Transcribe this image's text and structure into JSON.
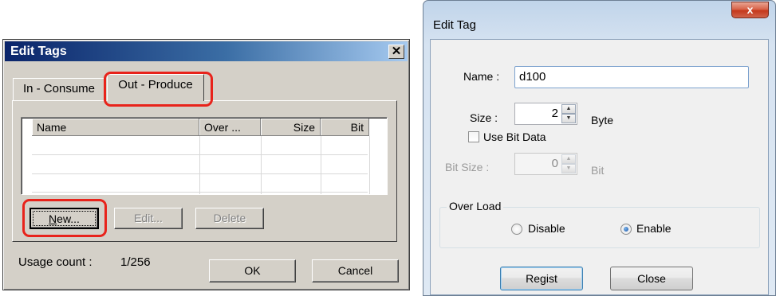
{
  "left_dialog": {
    "title": "Edit Tags",
    "close_glyph": "✕",
    "tabs": [
      {
        "label": "In - Consume",
        "selected": false
      },
      {
        "label": "Out - Produce",
        "selected": true
      }
    ],
    "table": {
      "columns": [
        "Name",
        "Over ...",
        "Size",
        "Bit"
      ],
      "rows": []
    },
    "buttons": {
      "new": {
        "label": "New...",
        "mnemonic": "N"
      },
      "edit": {
        "label": "Edit...",
        "enabled": false
      },
      "delete": {
        "label": "Delete",
        "enabled": false
      },
      "ok": "OK",
      "cancel": "Cancel"
    },
    "usage_label": "Usage count :",
    "usage_value": "1/256",
    "highlight_color": "#e8231b"
  },
  "right_dialog": {
    "title": "Edit Tag",
    "close_glyph": "x",
    "name_label": "Name :",
    "name_value": "d100",
    "size_label": "Size :",
    "size_value": "2",
    "size_unit": "Byte",
    "use_bit_data_label": "Use Bit Data",
    "use_bit_data_checked": false,
    "bit_size_label": "Bit Size :",
    "bit_size_value": "0",
    "bit_size_unit": "Bit",
    "overload": {
      "legend": "Over Load",
      "options": [
        {
          "label": "Disable",
          "selected": false
        },
        {
          "label": "Enable",
          "selected": true
        }
      ]
    },
    "buttons": {
      "regist": "Regist",
      "close": "Close"
    }
  },
  "icons": {
    "spin_up": "▲",
    "spin_down": "▼"
  }
}
